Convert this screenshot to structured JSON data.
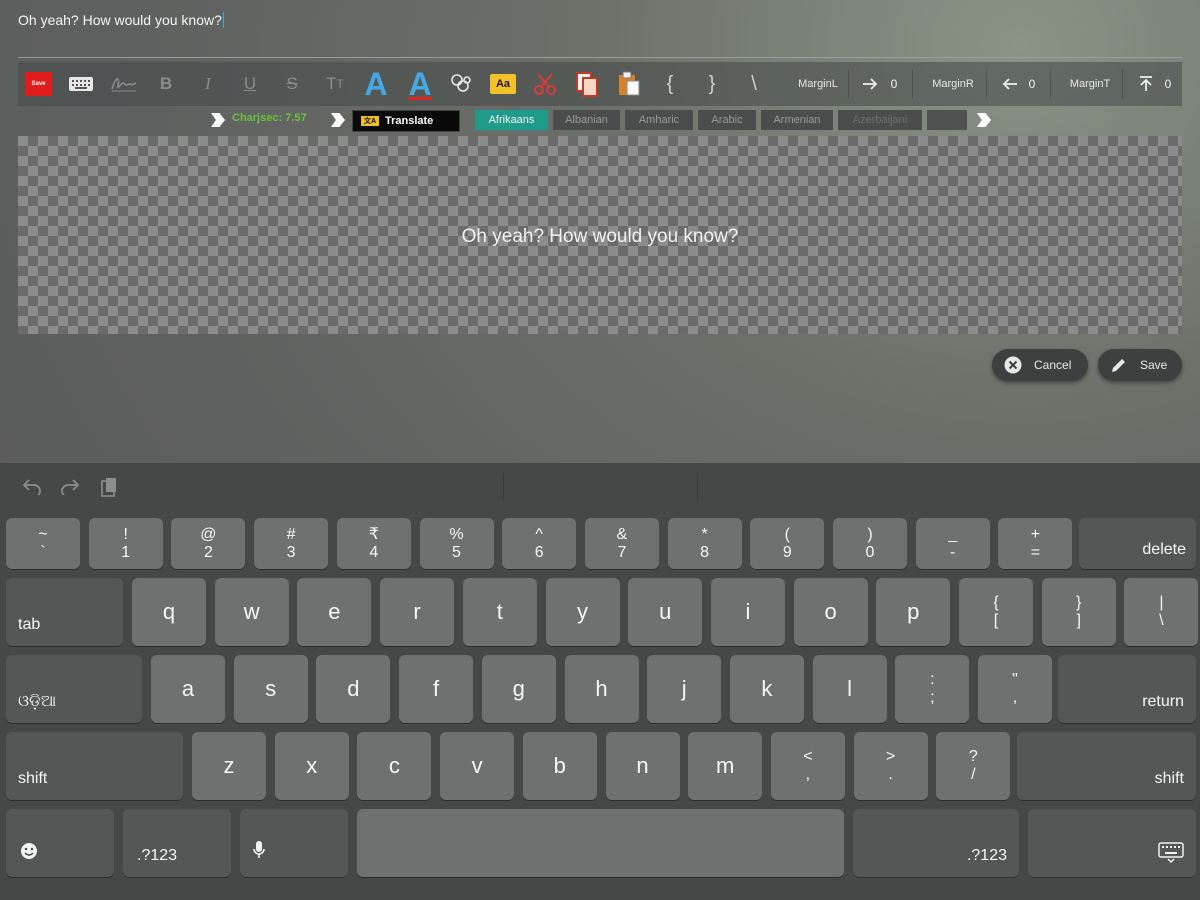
{
  "editor": {
    "text": "Oh yeah? How would you know?"
  },
  "toolbar": {
    "save_badge": "Save",
    "bold": "B",
    "italic": "I",
    "underline": "U",
    "strike": "S",
    "tt": "T",
    "font_a": "A",
    "color_a": "A",
    "aa": "Aa",
    "brace_open": "{",
    "brace_close": "}",
    "slash": "\\",
    "margin_left_label": "MarginL",
    "margin_left_value": "0",
    "margin_right_label": "MarginR",
    "margin_right_value": "0",
    "margin_top_label": "MarginT",
    "margin_top_value": "0"
  },
  "row2": {
    "charsec": "Charjsec: 7.57",
    "translate_icon": "文A",
    "translate_label": "Translate",
    "languages": [
      "Afrikaans",
      "Albanian",
      "Amharic",
      "Arabic",
      "Armenian",
      "Azerbaijani"
    ]
  },
  "canvas": {
    "text": "Oh yeah? How would you know?"
  },
  "actions": {
    "cancel": "Cancel",
    "save": "Save"
  },
  "keyboard": {
    "row1": [
      {
        "top": "~",
        "bottom": "`"
      },
      {
        "top": "!",
        "bottom": "1"
      },
      {
        "top": "@",
        "bottom": "2"
      },
      {
        "top": "#",
        "bottom": "3"
      },
      {
        "top": "₹",
        "bottom": "4"
      },
      {
        "top": "%",
        "bottom": "5"
      },
      {
        "top": "^",
        "bottom": "6"
      },
      {
        "top": "&",
        "bottom": "7"
      },
      {
        "top": "*",
        "bottom": "8"
      },
      {
        "top": "(",
        "bottom": "9"
      },
      {
        "top": ")",
        "bottom": "0"
      },
      {
        "top": "_",
        "bottom": "-"
      },
      {
        "top": "+",
        "bottom": "="
      }
    ],
    "delete": "delete",
    "tab": "tab",
    "row2": [
      "q",
      "w",
      "e",
      "r",
      "t",
      "y",
      "u",
      "i",
      "o",
      "p"
    ],
    "row2_sym": [
      {
        "top": "{",
        "bottom": "["
      },
      {
        "top": "}",
        "bottom": "]"
      },
      {
        "top": "|",
        "bottom": "\\"
      }
    ],
    "lang_key": "ଓଡ଼ିଆ",
    "row3": [
      "a",
      "s",
      "d",
      "f",
      "g",
      "h",
      "j",
      "k",
      "l"
    ],
    "row3_sym": [
      {
        "top": ":",
        "bottom": ";"
      },
      {
        "top": "\"",
        "bottom": ","
      }
    ],
    "return": "return",
    "shift_left": "shift",
    "row4": [
      "z",
      "x",
      "c",
      "v",
      "b",
      "n",
      "m"
    ],
    "row4_sym": [
      {
        "top": "<",
        "bottom": ","
      },
      {
        "top": ">",
        "bottom": "."
      },
      {
        "top": "?",
        "bottom": "/"
      }
    ],
    "shift_right": "shift",
    "num_left": ".?123",
    "num_right": ".?123"
  },
  "colors": {
    "accent_red": "#e01c1c",
    "lang_active": "#1f9b89",
    "charsec_green": "#6bbf3b",
    "caret": "#41a9d9"
  }
}
